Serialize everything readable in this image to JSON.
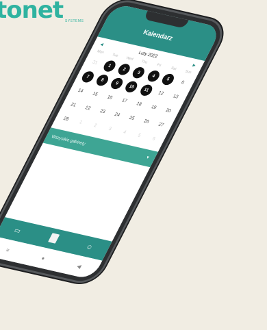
{
  "brand": {
    "name": "tonet",
    "tagline": "SYSTEMS"
  },
  "colors": {
    "primary": "#2b8f86",
    "select_bg": "#3ea594",
    "marked_day": "#111111",
    "background": "#f1ede3"
  },
  "app": {
    "title": "Kalendarz"
  },
  "calendar": {
    "month_label": "Luty 2022",
    "prev_icon": "chevron-left-icon",
    "next_icon": "chevron-right-icon",
    "weekdays": [
      "Mon",
      "Tue",
      "Wed",
      "Thu",
      "Fri",
      "Sat",
      "Sun"
    ],
    "days": [
      {
        "n": "31",
        "dim": true,
        "marked": false
      },
      {
        "n": "1",
        "dim": false,
        "marked": true
      },
      {
        "n": "2",
        "dim": false,
        "marked": true
      },
      {
        "n": "3",
        "dim": false,
        "marked": true
      },
      {
        "n": "4",
        "dim": false,
        "marked": true
      },
      {
        "n": "5",
        "dim": false,
        "marked": true
      },
      {
        "n": "6",
        "dim": false,
        "marked": false
      },
      {
        "n": "7",
        "dim": false,
        "marked": true
      },
      {
        "n": "8",
        "dim": false,
        "marked": true
      },
      {
        "n": "9",
        "dim": false,
        "marked": true
      },
      {
        "n": "10",
        "dim": false,
        "marked": true
      },
      {
        "n": "11",
        "dim": false,
        "marked": true
      },
      {
        "n": "12",
        "dim": false,
        "marked": false
      },
      {
        "n": "13",
        "dim": false,
        "marked": false
      },
      {
        "n": "14",
        "dim": false,
        "marked": false
      },
      {
        "n": "15",
        "dim": false,
        "marked": false
      },
      {
        "n": "16",
        "dim": false,
        "marked": false
      },
      {
        "n": "17",
        "dim": false,
        "marked": false
      },
      {
        "n": "18",
        "dim": false,
        "marked": false
      },
      {
        "n": "19",
        "dim": false,
        "marked": false
      },
      {
        "n": "20",
        "dim": false,
        "marked": false
      },
      {
        "n": "21",
        "dim": false,
        "marked": false
      },
      {
        "n": "22",
        "dim": false,
        "marked": false
      },
      {
        "n": "23",
        "dim": false,
        "marked": false
      },
      {
        "n": "24",
        "dim": false,
        "marked": false
      },
      {
        "n": "25",
        "dim": false,
        "marked": false
      },
      {
        "n": "26",
        "dim": false,
        "marked": false
      },
      {
        "n": "27",
        "dim": false,
        "marked": false
      },
      {
        "n": "28",
        "dim": false,
        "marked": false
      },
      {
        "n": "1",
        "dim": true,
        "marked": false
      },
      {
        "n": "2",
        "dim": true,
        "marked": false
      },
      {
        "n": "3",
        "dim": true,
        "marked": false
      },
      {
        "n": "4",
        "dim": true,
        "marked": false
      },
      {
        "n": "5",
        "dim": true,
        "marked": false
      },
      {
        "n": "6",
        "dim": true,
        "marked": false
      }
    ]
  },
  "filter": {
    "label": "Wszystkie gabinety",
    "icon": "chevron-down-icon"
  },
  "bottom_nav": [
    {
      "name": "chat-icon",
      "glyph": "▭",
      "active": false
    },
    {
      "name": "calendar-icon",
      "glyph": "",
      "active": true
    },
    {
      "name": "users-icon",
      "glyph": "☺",
      "active": false
    }
  ],
  "system_nav": [
    {
      "name": "recents-icon",
      "glyph": "≡"
    },
    {
      "name": "home-icon",
      "glyph": "●"
    },
    {
      "name": "back-icon",
      "glyph": "◀"
    }
  ]
}
